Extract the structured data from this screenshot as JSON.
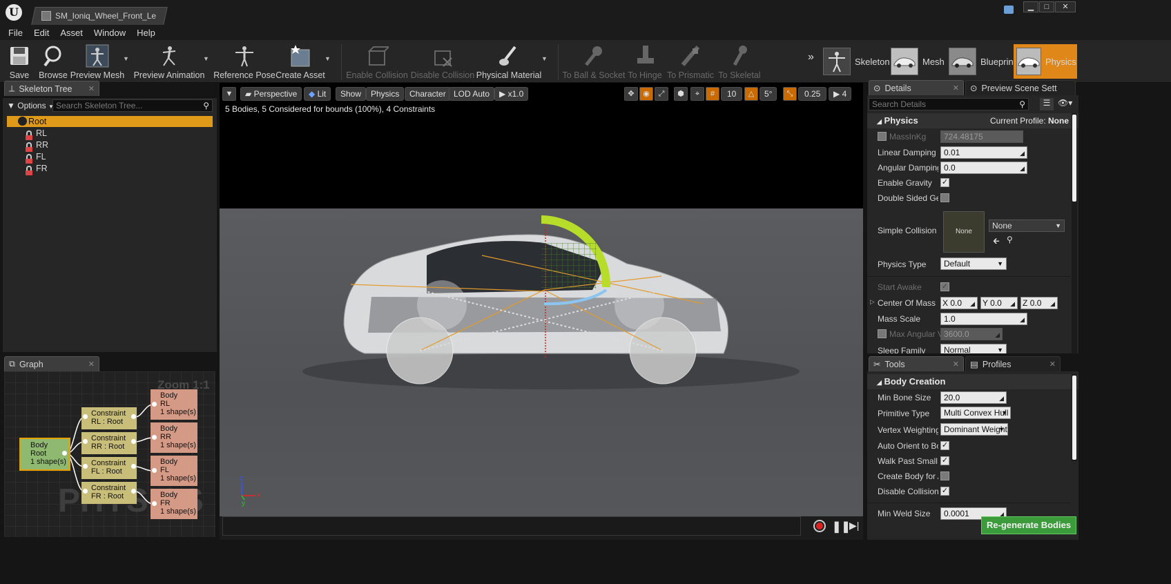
{
  "window": {
    "tab_title": "SM_Ioniq_Wheel_Front_Le",
    "minimize": "▁",
    "maximize": "□",
    "close": "✕"
  },
  "menu": [
    "File",
    "Edit",
    "Asset",
    "Window",
    "Help"
  ],
  "toolbar": {
    "save": "Save",
    "browse": "Browse",
    "preview_mesh": "Preview Mesh",
    "preview_animation": "Preview Animation",
    "reference_pose": "Reference Pose",
    "create_asset": "Create Asset",
    "enable_collision": "Enable Collision",
    "disable_collision": "Disable Collision",
    "physical_material": "Physical Material",
    "to_ball_socket": "To Ball & Socket",
    "to_hinge": "To Hinge",
    "to_prismatic": "To Prismatic",
    "to_skeletal": "To Skeletal"
  },
  "modes": {
    "skeleton": "Skeleton",
    "mesh": "Mesh",
    "blueprint": "Blueprint",
    "physics": "Physics",
    "active_color": "#e0871a"
  },
  "skeleton_tree": {
    "tab": "Skeleton Tree",
    "options": "Options",
    "search_placeholder": "Search Skeleton Tree...",
    "root": "Root",
    "bones": [
      "RL",
      "RR",
      "FL",
      "FR"
    ]
  },
  "graph": {
    "tab": "Graph",
    "zoom": "Zoom 1:1",
    "watermark": "PHYSICS",
    "root_node": {
      "title": "Body",
      "name": "Root",
      "shapes": "1 shape(s)"
    },
    "constraints": [
      {
        "title": "Constraint",
        "name": "RL : Root"
      },
      {
        "title": "Constraint",
        "name": "RR : Root"
      },
      {
        "title": "Constraint",
        "name": "FL : Root"
      },
      {
        "title": "Constraint",
        "name": "FR : Root"
      }
    ],
    "bodies": [
      {
        "title": "Body",
        "name": "RL",
        "shapes": "1 shape(s)"
      },
      {
        "title": "Body",
        "name": "RR",
        "shapes": "1 shape(s)"
      },
      {
        "title": "Body",
        "name": "FL",
        "shapes": "1 shape(s)"
      },
      {
        "title": "Body",
        "name": "FR",
        "shapes": "1 shape(s)"
      }
    ]
  },
  "viewport": {
    "perspective": "Perspective",
    "lit": "Lit",
    "show": "Show",
    "physics": "Physics",
    "character": "Character",
    "lod": "LOD Auto",
    "speed": "x1.0",
    "grid_snap": "10",
    "rot_snap": "5°",
    "scale_snap": "0.25",
    "cam_speed": "4",
    "status": "5 Bodies, 5 Considered for bounds (100%), 4 Constraints"
  },
  "details": {
    "tab": "Details",
    "tab2": "Preview Scene Sett",
    "search_placeholder": "Search Details",
    "section": "Physics",
    "profile_label": "Current Profile:",
    "profile_value": "None",
    "mass_label": "MassInKg",
    "mass_value": "724.48175",
    "linear_damping_label": "Linear Damping",
    "linear_damping_value": "0.01",
    "angular_damping_label": "Angular Damping",
    "angular_damping_value": "0.0",
    "enable_gravity_label": "Enable Gravity",
    "double_sided_label": "Double Sided Geom",
    "simple_collision_label": "Simple Collision Ph",
    "simple_collision_thumb": "None",
    "simple_collision_value": "None",
    "physics_type_label": "Physics Type",
    "physics_type_value": "Default",
    "start_awake_label": "Start Awake",
    "center_mass_label": "Center Of Mass Of",
    "com_x": "0.0",
    "com_y": "0.0",
    "com_z": "0.0",
    "axis_x": "X",
    "axis_y": "Y",
    "axis_z": "Z",
    "mass_scale_label": "Mass Scale",
    "mass_scale_value": "1.0",
    "max_ang_label": "Max Angular V",
    "max_ang_value": "3600.0",
    "sleep_family_label": "Sleep Family",
    "sleep_family_value": "Normal"
  },
  "tools": {
    "tab": "Tools",
    "tab2": "Profiles",
    "section": "Body Creation",
    "min_bone_label": "Min Bone Size",
    "min_bone_value": "20.0",
    "primitive_label": "Primitive Type",
    "primitive_value": "Multi Convex Hull",
    "vertex_label": "Vertex Weighting T",
    "vertex_value": "Dominant Weight",
    "auto_orient_label": "Auto Orient to Bone",
    "walk_past_label": "Walk Past Small Bo",
    "create_body_label": "Create Body for All",
    "disable_coll_label": "Disable Collisions b",
    "min_weld_label": "Min Weld Size",
    "min_weld_value": "0.0001",
    "regenerate": "Re-generate Bodies"
  }
}
